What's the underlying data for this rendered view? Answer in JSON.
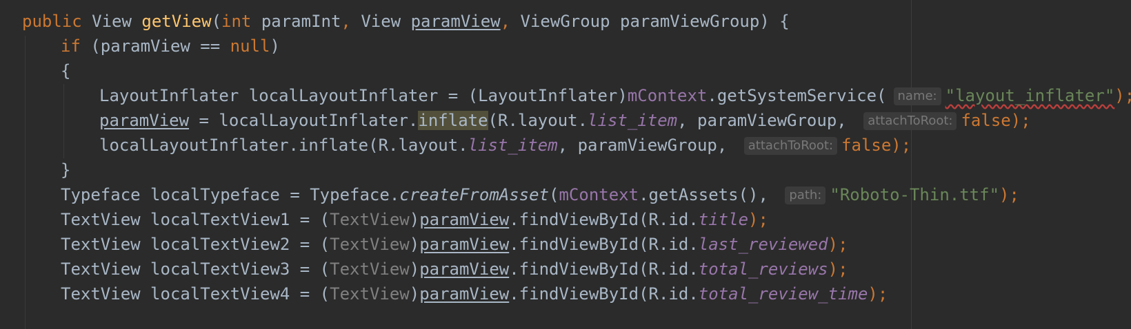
{
  "editor": {
    "line1": {
      "kw_public": "public",
      "type_view": " View ",
      "method": "getView",
      "open_paren": "(",
      "kw_int": "int",
      "param_int": " paramInt",
      "comma1": ", ",
      "type_view2": "View ",
      "param_view": "paramView",
      "comma2": ", ",
      "type_viewgroup": "ViewGroup paramViewGroup) {"
    },
    "line2": {
      "kw_if": "if",
      "cond_start": " (paramView == ",
      "kw_null": "null",
      "cond_end": ")"
    },
    "line3": {
      "text": "{"
    },
    "line4": {
      "prefix": "LayoutInflater localLayoutInflater = (LayoutInflater)",
      "field": "mContext",
      "call": ".getSystemService(",
      "hint": "name:",
      "string": "\"layout_inflater\"",
      "end": ");"
    },
    "line5": {
      "var": "paramView",
      "mid": " = localLayoutInflater.",
      "method": "inflate",
      "args_start": "(R.layout.",
      "item": "list_item",
      "args_mid": ", paramViewGroup, ",
      "hint": "attachToRoot:",
      "kw_false": "false",
      "end": ");"
    },
    "line6": {
      "prefix": "localLayoutInflater.inflate(R.layout.",
      "item": "list_item",
      "args_mid": ", paramViewGroup, ",
      "hint": "attachToRoot:",
      "kw_false": "false",
      "end": ");"
    },
    "line7": {
      "text": "}"
    },
    "line8": {
      "prefix": "Typeface localTypeface = Typeface.",
      "method": "createFromAsset",
      "open": "(",
      "field": "mContext",
      "call": ".getAssets(), ",
      "hint": "path:",
      "string": "\"Roboto-Thin.ttf\"",
      "end": ");"
    },
    "lines_textview": [
      {
        "prefix": "TextView localTextView1 = (",
        "cast": "TextView",
        "close": ")",
        "var": "paramView",
        "call": ".findViewById(R.id.",
        "id": "title",
        "end": ");"
      },
      {
        "prefix": "TextView localTextView2 = (",
        "cast": "TextView",
        "close": ")",
        "var": "paramView",
        "call": ".findViewById(R.id.",
        "id": "last_reviewed",
        "end": ");"
      },
      {
        "prefix": "TextView localTextView3 = (",
        "cast": "TextView",
        "close": ")",
        "var": "paramView",
        "call": ".findViewById(R.id.",
        "id": "total_reviews",
        "end": ");"
      },
      {
        "prefix": "TextView localTextView4 = (",
        "cast": "TextView",
        "close": ")",
        "var": "paramView",
        "call": ".findViewById(R.id.",
        "id": "total_review_time",
        "end": ");"
      }
    ]
  },
  "colors": {
    "background": "#2b2b2b",
    "default_text": "#a9b7c6",
    "keyword": "#cc7832",
    "method_decl": "#ffc66d",
    "string": "#6a8759",
    "field": "#9876aa",
    "redundant_cast": "#808080",
    "parameter_hint_bg": "#3b3b3b",
    "parameter_hint_text": "#787878"
  }
}
